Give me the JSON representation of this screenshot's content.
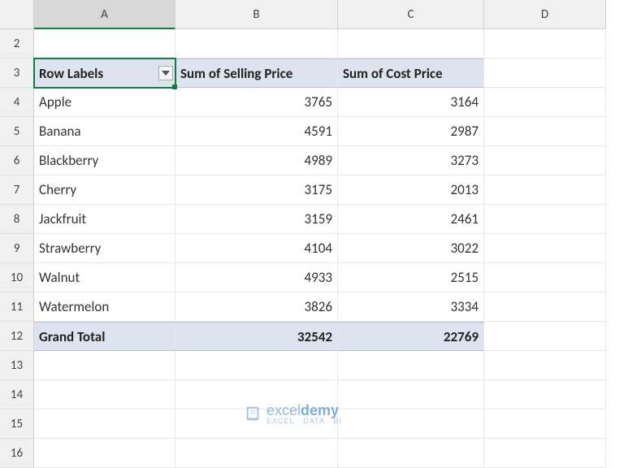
{
  "columns": [
    "A",
    "B",
    "C",
    "D"
  ],
  "row_numbers": [
    2,
    3,
    4,
    5,
    6,
    7,
    8,
    9,
    10,
    11,
    12,
    13,
    14,
    15,
    16
  ],
  "active_column_index": 0,
  "selected_cell": {
    "col": 0,
    "row": 3
  },
  "pivot": {
    "header": {
      "row_labels": "Row Labels",
      "col1": "Sum of Selling Price",
      "col2": "Sum of Cost Price"
    },
    "rows": [
      {
        "label": "Apple",
        "v1": "3765",
        "v2": "3164"
      },
      {
        "label": "Banana",
        "v1": "4591",
        "v2": "2987"
      },
      {
        "label": "Blackberry",
        "v1": "4989",
        "v2": "3273"
      },
      {
        "label": "Cherry",
        "v1": "3175",
        "v2": "2013"
      },
      {
        "label": "Jackfruit",
        "v1": "3159",
        "v2": "2461"
      },
      {
        "label": "Strawberry",
        "v1": "4104",
        "v2": "3022"
      },
      {
        "label": "Walnut",
        "v1": "4933",
        "v2": "2515"
      },
      {
        "label": "Watermelon",
        "v1": "3826",
        "v2": "3334"
      }
    ],
    "grand_total": {
      "label": "Grand Total",
      "v1": "32542",
      "v2": "22769"
    }
  },
  "watermark": {
    "brand_normal": "excel",
    "brand_bold": "demy",
    "sub": "EXCEL · DATA · BI"
  }
}
